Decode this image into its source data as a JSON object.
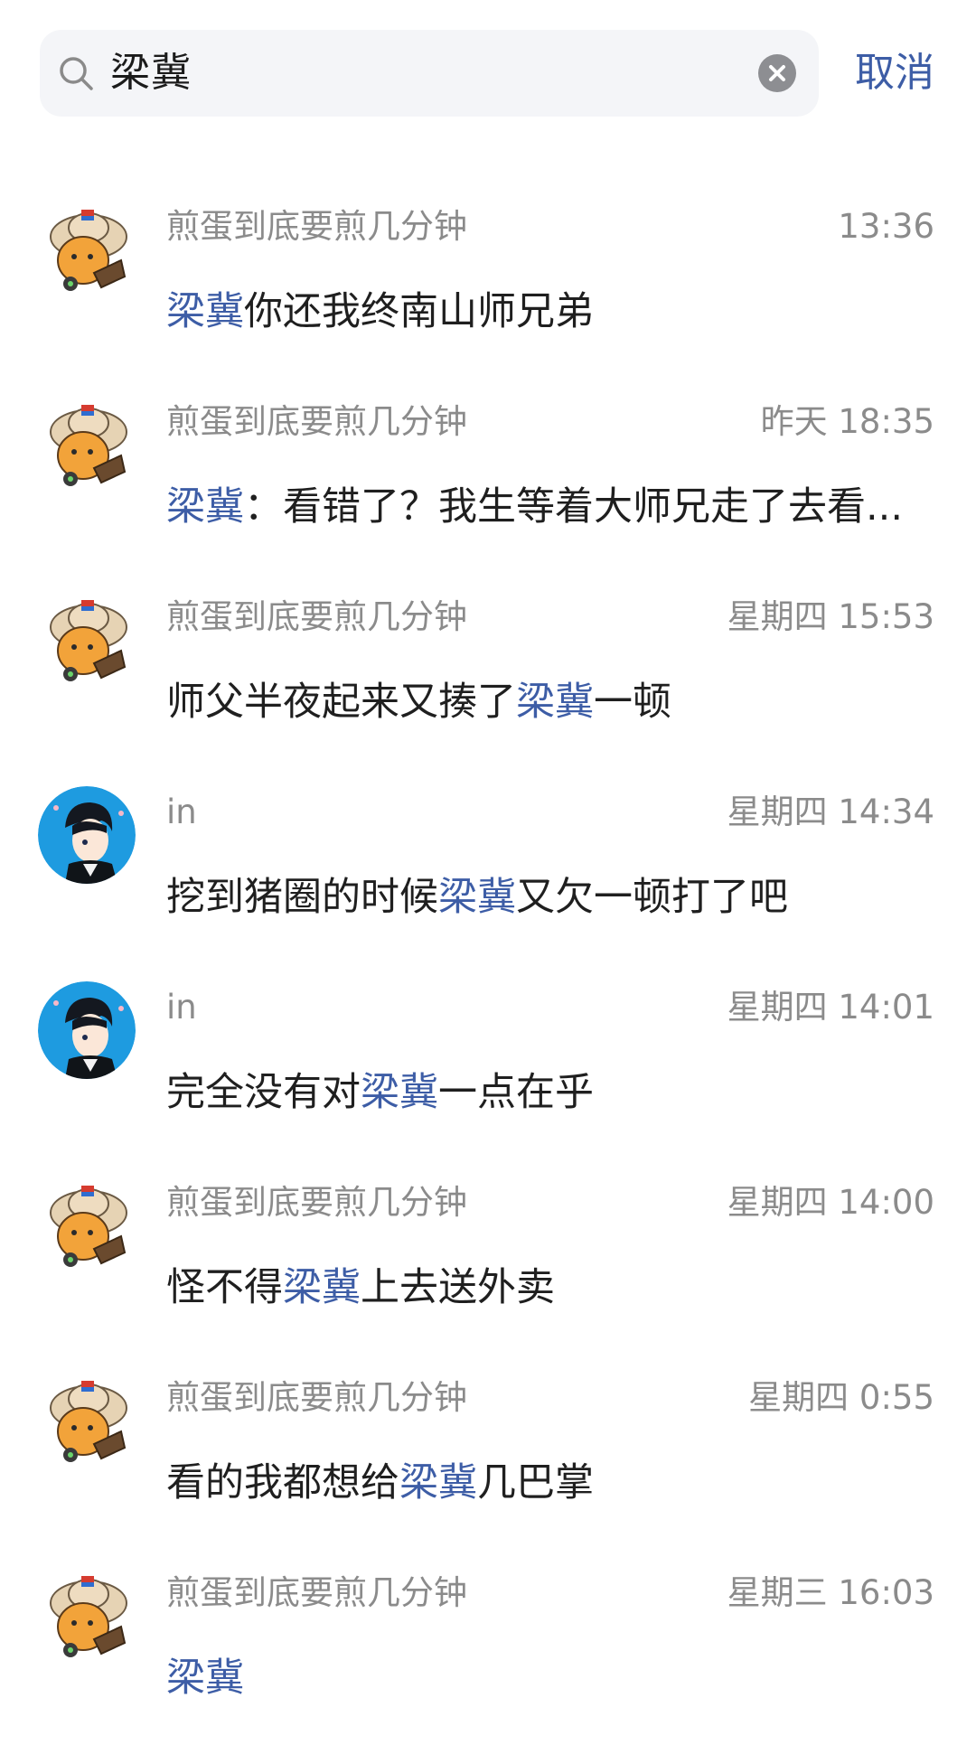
{
  "search": {
    "query": "梁冀",
    "cancel_label": "取消"
  },
  "results": [
    {
      "avatar": "cartoon-character-avatar",
      "name": "煎蛋到底要煎几分钟",
      "time": "13:36",
      "pre": "",
      "hl": "梁冀",
      "post": "你还我终南山师兄弟"
    },
    {
      "avatar": "cartoon-character-avatar",
      "name": "煎蛋到底要煎几分钟",
      "time": "昨天 18:35",
      "pre": "",
      "hl": "梁冀",
      "post": "：看错了？我生等着大师兄走了去看..."
    },
    {
      "avatar": "cartoon-character-avatar",
      "name": "煎蛋到底要煎几分钟",
      "time": "星期四 15:53",
      "pre": "师父半夜起来又揍了",
      "hl": "梁冀",
      "post": "一顿"
    },
    {
      "avatar": "anime-boy-avatar",
      "name": "in",
      "time": "星期四 14:34",
      "pre": "挖到猪圈的时候",
      "hl": "梁冀",
      "post": "又欠一顿打了吧"
    },
    {
      "avatar": "anime-boy-avatar",
      "name": "in",
      "time": "星期四 14:01",
      "pre": "完全没有对",
      "hl": "梁冀",
      "post": "一点在乎"
    },
    {
      "avatar": "cartoon-character-avatar",
      "name": "煎蛋到底要煎几分钟",
      "time": "星期四 14:00",
      "pre": "怪不得",
      "hl": "梁冀",
      "post": "上去送外卖"
    },
    {
      "avatar": "cartoon-character-avatar",
      "name": "煎蛋到底要煎几分钟",
      "time": "星期四 0:55",
      "pre": "看的我都想给",
      "hl": "梁冀",
      "post": "几巴掌"
    },
    {
      "avatar": "cartoon-character-avatar",
      "name": "煎蛋到底要煎几分钟",
      "time": "星期三 16:03",
      "pre": "",
      "hl": "梁冀",
      "post": ""
    }
  ],
  "colors": {
    "accent": "#3d5da6",
    "meta_text": "#8b8b8b",
    "search_bg": "#f4f5f8"
  }
}
